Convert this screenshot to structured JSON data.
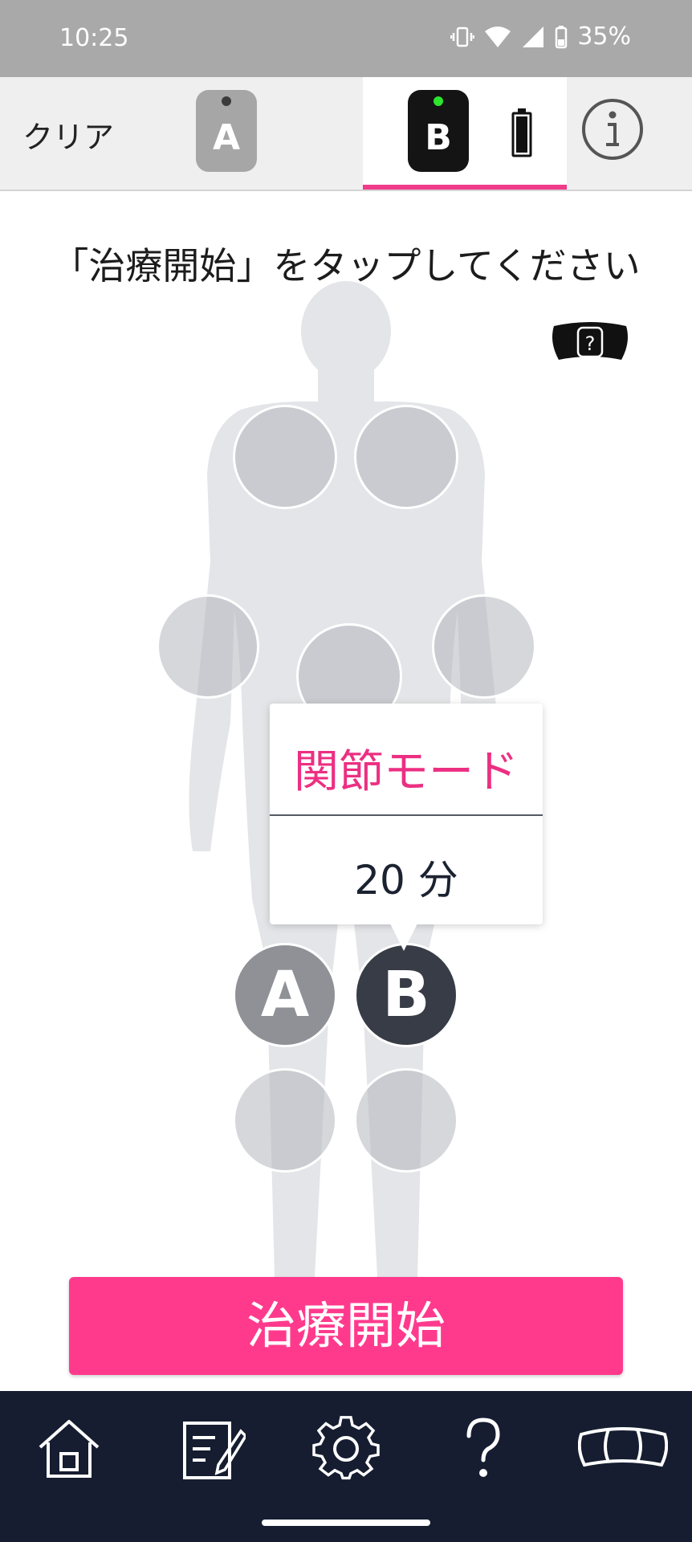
{
  "status_bar": {
    "time": "10:25",
    "battery": "35%"
  },
  "top_bar": {
    "clear_label": "クリア",
    "device_a_label": "A",
    "device_b_label": "B",
    "device_b_status_color": "#2ee52e",
    "selected_tab_accent": "#f03a8a"
  },
  "instruction": "「治療開始」をタップしてください",
  "popup": {
    "mode": "関節モード",
    "duration": "20 分"
  },
  "pads": {
    "a_label": "A",
    "b_label": "B"
  },
  "start_button": "治療開始",
  "bottom_nav": {
    "items": [
      "home-icon",
      "notes-icon",
      "settings-icon",
      "help-icon",
      "pads-icon"
    ]
  },
  "colors": {
    "accent": "#ff3a8d",
    "nav_background": "#161d31",
    "pad_a": "#8f9196",
    "pad_b": "#383c46"
  }
}
